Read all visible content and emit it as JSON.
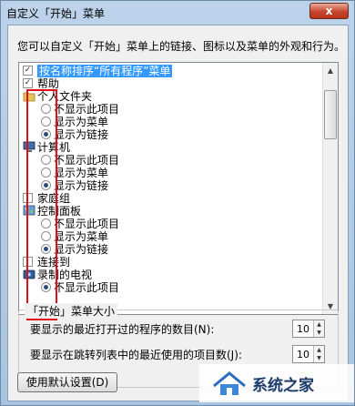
{
  "window": {
    "title": "自定义「开始」菜单",
    "close_label": "x"
  },
  "description": "您可以自定义「开始」菜单上的链接、图标以及菜单的外观和行为。",
  "options": {
    "sort_by_name": {
      "label": "按名称排序“所有程序”菜单",
      "checked": true
    },
    "help": {
      "label": "帮助",
      "checked": true
    },
    "personal_folder": {
      "label": "个人文件夹",
      "choices": [
        "不显示此项目",
        "显示为菜单",
        "显示为链接"
      ],
      "selected": 2
    },
    "computer": {
      "label": "计算机",
      "choices": [
        "不显示此项目",
        "显示为菜单",
        "显示为链接"
      ],
      "selected": 2
    },
    "homegroup": {
      "label": "家庭组",
      "checked": false
    },
    "control_panel": {
      "label": "控制面板",
      "choices": [
        "不显示此项目",
        "显示为菜单",
        "显示为链接"
      ],
      "selected": 2
    },
    "connect_to": {
      "label": "连接到",
      "checked": false
    },
    "recorded_tv": {
      "label": "录制的电视",
      "choices": [
        "不显示此项目"
      ],
      "selected": 0
    }
  },
  "size_group": {
    "title": "「开始」菜单大小",
    "recent_programs_label": "要显示的最近打开过的程序的数目(N):",
    "recent_programs_value": "10",
    "jump_list_label": "要显示在跳转列表中的最近使用的项目数(J):",
    "jump_list_value": "10"
  },
  "buttons": {
    "use_defaults": "使用默认设置(D)"
  },
  "watermark": {
    "text": "系统之家"
  },
  "colors": {
    "selection": "#3399ff",
    "highlight_box": "#e0101a"
  }
}
